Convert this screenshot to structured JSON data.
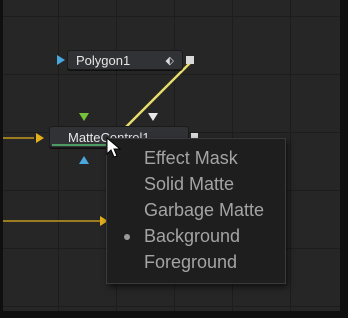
{
  "nodes": {
    "polygon": {
      "label": "Polygon1",
      "icon": "polygon-mask-icon"
    },
    "matte_control": {
      "label": "MatteControl1"
    }
  },
  "context_menu": {
    "items": [
      {
        "label": "Effect Mask",
        "selected": false
      },
      {
        "label": "Solid Matte",
        "selected": false
      },
      {
        "label": "Garbage Matte",
        "selected": false
      },
      {
        "label": "Background",
        "selected": true
      },
      {
        "label": "Foreground",
        "selected": false
      }
    ]
  },
  "colors": {
    "canvas": "#262626",
    "node_body": "#303236",
    "wire_active": "#e8dd6a",
    "wire_input": "#e3b01c",
    "port_mask_input": "#4aa8e0",
    "port_foreground": "#78c23a",
    "selected_underline": "#4e9a63",
    "menu_bg": "#1e1e1e",
    "menu_text": "#a4a4a4"
  }
}
